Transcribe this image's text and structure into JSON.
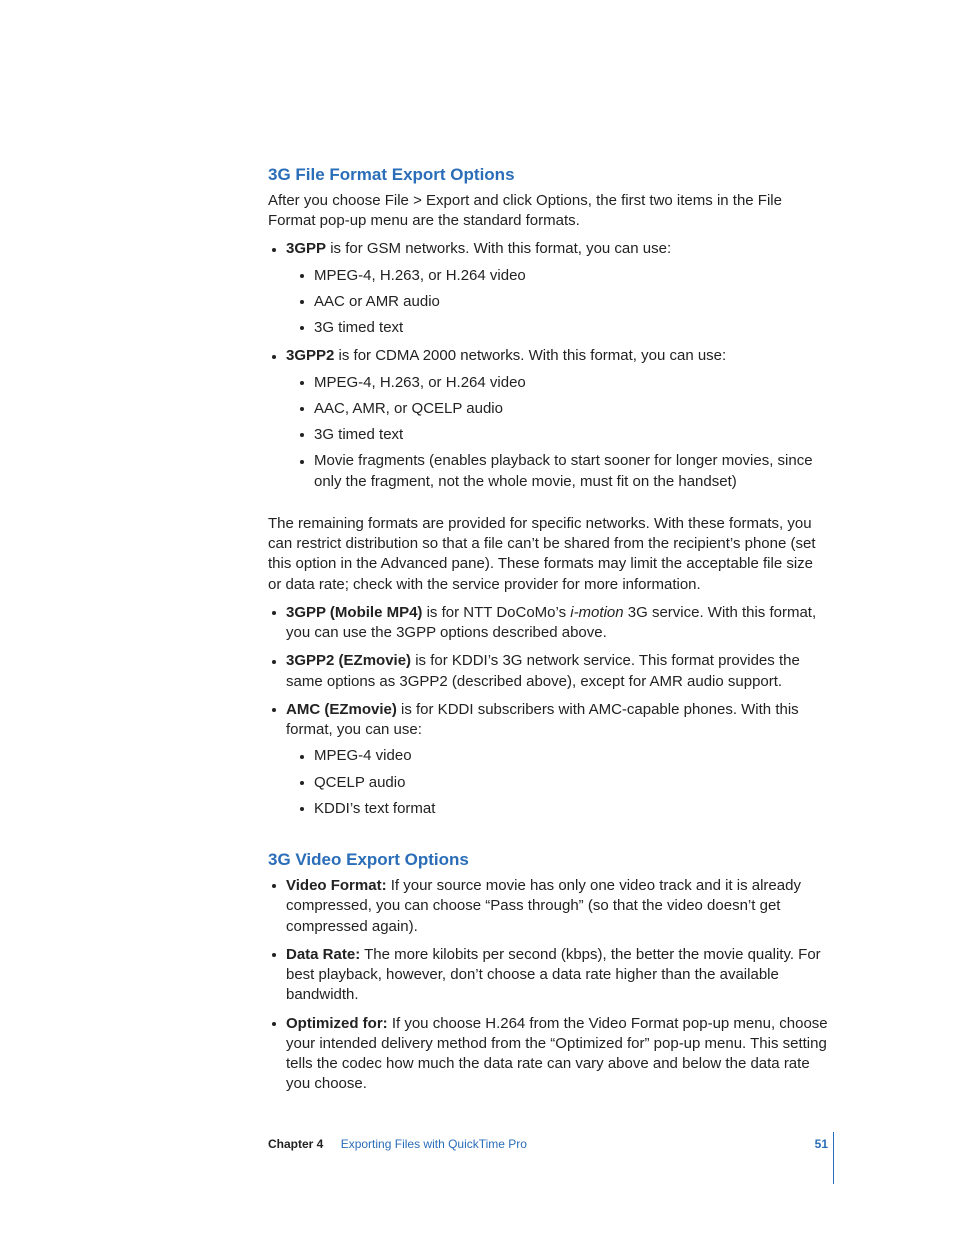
{
  "section1": {
    "heading": "3G File Format Export Options",
    "intro": "After you choose File > Export and click Options, the first two items in the File Format pop-up menu are the standard formats.",
    "items": [
      {
        "bold": "3GPP",
        "rest": " is for GSM networks. With this format, you can use:",
        "sub": [
          "MPEG-4, H.263, or H.264 video",
          "AAC or AMR audio",
          "3G timed text"
        ]
      },
      {
        "bold": "3GPP2",
        "rest": " is for CDMA 2000 networks. With this format, you can use:",
        "sub": [
          "MPEG-4, H.263, or H.264 video",
          "AAC, AMR, or QCELP audio",
          "3G timed text",
          "Movie fragments (enables playback to start sooner for longer movies, since only the fragment, not the whole movie, must fit on the handset)"
        ]
      }
    ],
    "para2": "The remaining formats are provided for specific networks. With these formats, you can restrict distribution so that a file can’t be shared from the recipient’s phone (set this option in the Advanced pane). These formats may limit the acceptable file size or data rate; check with the service provider for more information.",
    "items2": [
      {
        "bold": "3GPP (Mobile MP4)",
        "pre": " is for NTT DoCoMo’s ",
        "ital": "i-motion",
        "post": " 3G service. With this format, you can use the 3GPP options described above."
      },
      {
        "bold": "3GPP2 (EZmovie)",
        "pre": " is for KDDI’s 3G network service. This format provides the same options as 3GPP2 (described above), except for AMR audio support.",
        "ital": "",
        "post": ""
      },
      {
        "bold": "AMC (EZmovie)",
        "pre": " is for KDDI subscribers with AMC-capable phones. With this format, you can use:",
        "ital": "",
        "post": "",
        "sub": [
          "MPEG-4 video",
          "QCELP audio",
          "KDDI’s text format"
        ]
      }
    ]
  },
  "section2": {
    "heading": "3G Video Export Options",
    "items": [
      {
        "bold": "Video Format:",
        "rest": "  If your source movie has only one video track and it is already compressed, you can choose “Pass through” (so that the video doesn’t get compressed again)."
      },
      {
        "bold": "Data Rate:",
        "rest": "  The more kilobits per second (kbps), the better the movie quality. For best playback, however, don’t choose a data rate higher than the available bandwidth."
      },
      {
        "bold": "Optimized for:",
        "rest": "  If you choose H.264 from the Video Format pop-up menu, choose your intended delivery method from the “Optimized for” pop-up menu. This setting tells the codec how much the data rate can vary above and below the data rate you choose."
      }
    ]
  },
  "footer": {
    "chapter": "Chapter 4",
    "title": "Exporting Files with QuickTime Pro",
    "page": "51"
  }
}
